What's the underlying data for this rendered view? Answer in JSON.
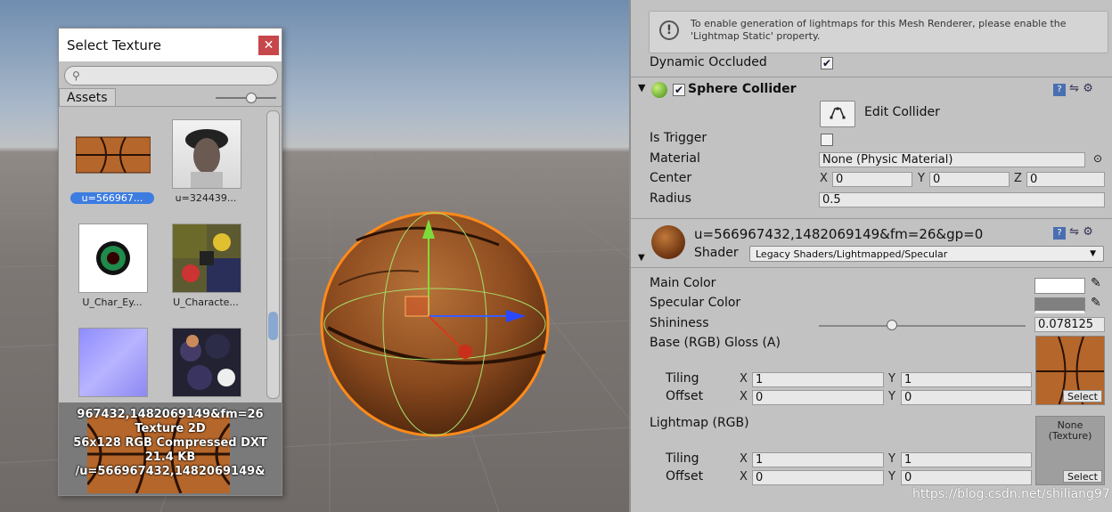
{
  "picker": {
    "title": "Select Texture",
    "close_glyph": "✕",
    "search_placeholder": "",
    "tab_label": "Assets",
    "items": [
      {
        "caption": "u=566967...",
        "selected": true
      },
      {
        "caption": "u=324439..."
      },
      {
        "caption": "U_Char_Ey..."
      },
      {
        "caption": "U_Characte..."
      },
      {
        "caption": ""
      },
      {
        "caption": ""
      }
    ],
    "preview": {
      "name": "967432,1482069149&fm=26",
      "type": "Texture 2D",
      "format": "56x128  RGB Compressed DXT",
      "size": "21.4 KB",
      "path": "/u=566967432,1482069149&"
    }
  },
  "inspector": {
    "lightmap_help": "To enable generation of lightmaps for this Mesh Renderer, please enable the 'Lightmap Static' property.",
    "dynamic_occluded_label": "Dynamic Occluded",
    "dynamic_occluded_checked": "✔",
    "sphere_collider": {
      "title": "Sphere Collider",
      "enabled_check": "✔",
      "edit_collider_label": "Edit Collider",
      "is_trigger_label": "Is Trigger",
      "material_label": "Material",
      "material_value": "None (Physic Material)",
      "center_label": "Center",
      "center": {
        "x": "0",
        "y": "0",
        "z": "0"
      },
      "radius_label": "Radius",
      "radius_value": "0.5"
    },
    "material": {
      "name": "u=566967432,1482069149&fm=26&gp=0",
      "shader_label": "Shader",
      "shader_value": "Legacy Shaders/Lightmapped/Specular",
      "main_color_label": "Main Color",
      "main_color": "#ffffff",
      "specular_color_label": "Specular Color",
      "specular_color": "#808080",
      "shininess_label": "Shininess",
      "shininess_value": "0.078125",
      "base_label": "Base (RGB) Gloss (A)",
      "lightmap_label": "Lightmap (RGB)",
      "tiling_label": "Tiling",
      "offset_label": "Offset",
      "base_tiling": {
        "x": "1",
        "y": "1"
      },
      "base_offset": {
        "x": "0",
        "y": "0"
      },
      "lightmap_tiling": {
        "x": "1",
        "y": "1"
      },
      "lightmap_offset": {
        "x": "0",
        "y": "0"
      },
      "lightmap_none": "None",
      "lightmap_none_type": "(Texture)",
      "select_label": "Select"
    },
    "axis_x": "X",
    "axis_y": "Y",
    "axis_z": "Z"
  },
  "watermark": "https://blog.csdn.net/shiliang97",
  "colors": {
    "selection": "#3d7ce0",
    "sphere": "#8b4a1e",
    "outline": "#ff8a1a"
  }
}
